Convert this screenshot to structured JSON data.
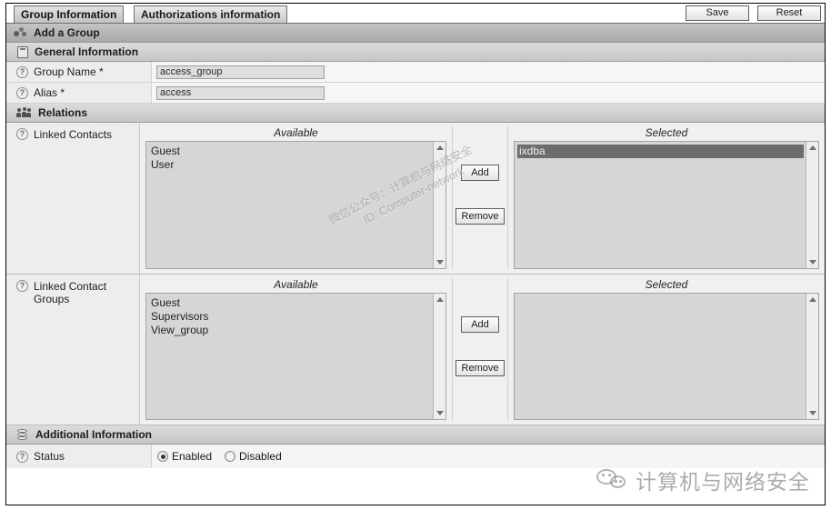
{
  "tabs": [
    {
      "label": "Group Information",
      "active": true
    },
    {
      "label": "Authorizations information",
      "active": false
    }
  ],
  "toolbar": {
    "save_label": "Save",
    "reset_label": "Reset"
  },
  "page_header": {
    "title": "Add a Group",
    "icon": "group-icon"
  },
  "sections": {
    "general": {
      "title": "General Information",
      "icon": "clipboard-icon",
      "fields": [
        {
          "label": "Group Name *",
          "value": "access_group",
          "icon": "help-icon"
        },
        {
          "label": "Alias *",
          "value": "access",
          "icon": "help-icon"
        }
      ]
    },
    "relations": {
      "title": "Relations",
      "icon": "people-icon",
      "rows": [
        {
          "label": "Linked Contacts",
          "icon": "help-icon",
          "available_header": "Available",
          "selected_header": "Selected",
          "available_items": [
            "Guest",
            "User"
          ],
          "selected_items": [
            "ixdba"
          ],
          "selected_highlight_index": 0,
          "add_label": "Add",
          "remove_label": "Remove"
        },
        {
          "label": "Linked Contact Groups",
          "icon": "help-icon",
          "available_header": "Available",
          "selected_header": "Selected",
          "available_items": [
            "Guest",
            "Supervisors",
            "View_group"
          ],
          "selected_items": [],
          "selected_highlight_index": -1,
          "add_label": "Add",
          "remove_label": "Remove"
        }
      ]
    },
    "additional": {
      "title": "Additional Information",
      "icon": "layers-icon",
      "status": {
        "label": "Status",
        "icon": "help-icon",
        "options": [
          {
            "label": "Enabled",
            "checked": true
          },
          {
            "label": "Disabled",
            "checked": false
          }
        ]
      }
    }
  },
  "watermarks": {
    "diagonal_line1": "微信公众号：计算机与网络安全",
    "diagonal_line2": "ID: Computer-network",
    "logo_text": "计算机与网络安全"
  },
  "colors": {
    "frame_border": "#000000",
    "header_bar": "#c4c4c4",
    "selection": "#6c6c6c",
    "list_bg": "#d6d6d6"
  }
}
